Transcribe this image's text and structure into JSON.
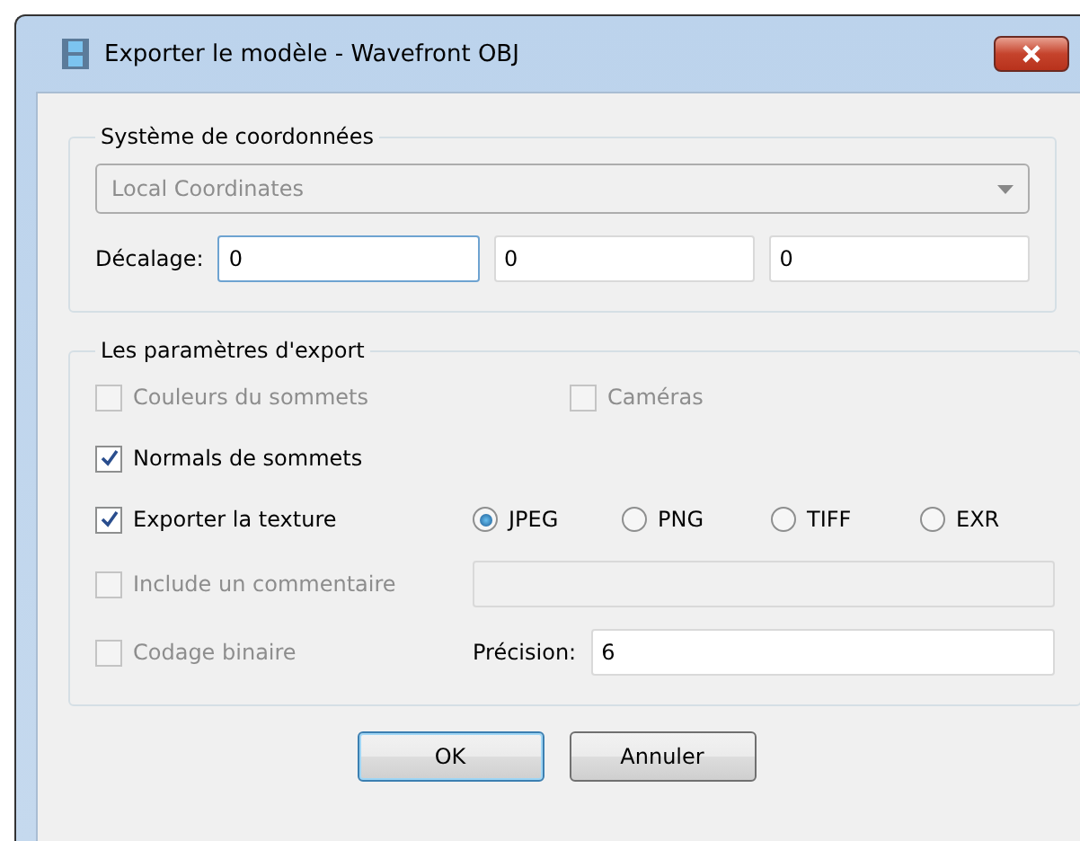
{
  "window": {
    "title": "Exporter le modèle - Wavefront OBJ"
  },
  "coordinate_system": {
    "title": "Système de coordonnées",
    "dropdown": {
      "value": "Local Coordinates",
      "disabled": true
    },
    "offset_label": "Décalage:",
    "offsets": [
      {
        "value": "0",
        "focused": true
      },
      {
        "value": "0",
        "focused": false
      },
      {
        "value": "0",
        "focused": false
      }
    ]
  },
  "export_settings": {
    "title": "Les paramètres d'export",
    "vertex_colors": {
      "label": "Couleurs du sommets",
      "checked": false,
      "disabled": true
    },
    "cameras": {
      "label": "Caméras",
      "checked": false,
      "disabled": true
    },
    "vertex_normals": {
      "label": "Normals de sommets",
      "checked": true,
      "disabled": false
    },
    "export_texture": {
      "label": "Exporter la texture",
      "checked": true,
      "disabled": false
    },
    "formats": [
      {
        "label": "JPEG",
        "selected": true
      },
      {
        "label": "PNG",
        "selected": false
      },
      {
        "label": "TIFF",
        "selected": false
      },
      {
        "label": "EXR",
        "selected": false
      }
    ],
    "comment": {
      "label": "Include un commentaire",
      "checked": false,
      "disabled": true,
      "field_disabled": true
    },
    "binary": {
      "label": "Codage binaire",
      "checked": false,
      "disabled": true
    },
    "precision": {
      "label": "Précision:",
      "value": "6"
    }
  },
  "buttons": [
    {
      "label": "OK",
      "default": true
    },
    {
      "label": "Annuler",
      "default": false
    }
  ]
}
